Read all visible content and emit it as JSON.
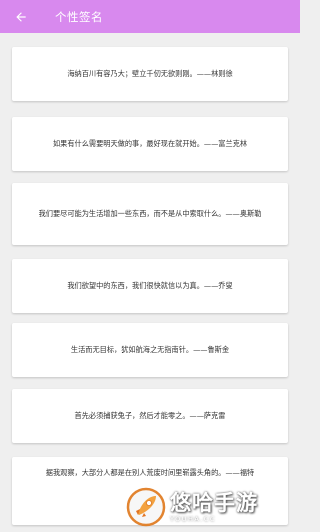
{
  "header": {
    "title": "个性签名",
    "back_icon": "arrow-left-icon",
    "background": "#d889ee"
  },
  "quotes": [
    "海纳百川有容乃大；壁立千仞无欲则刚。——林则徐",
    "如果有什么需要明天做的事，最好现在就开始。——富兰克林",
    "我们要尽可能为生活增加一些东西，而不是从中索取什么。——奥斯勒",
    "我们欲望中的东西，我们很快就信以为真。——乔叟",
    "生活而无目标，犹如航海之无指南针。——鲁斯金",
    "首先必须捕获兔子，然后才能零之。——萨克雷",
    "据我观察，大部分人都是在别人荒废时间里崭露头角的。——福特"
  ],
  "watermark": {
    "text": "悠哈手游",
    "subtext": "YOUHA.CC",
    "logo_icon": "rocket-logo-icon"
  }
}
